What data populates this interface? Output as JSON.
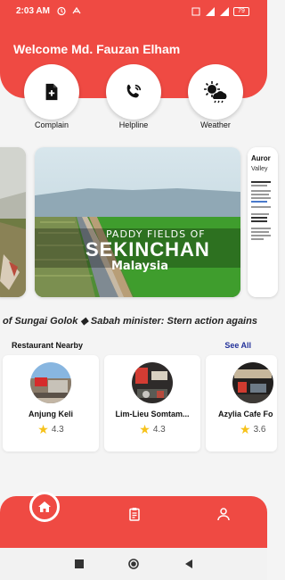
{
  "status": {
    "time": "2:03 AM",
    "battery": "79"
  },
  "header": {
    "welcome": "Welcome Md. Fauzan Elham"
  },
  "quick_actions": [
    {
      "label": "Complain",
      "icon": "add-file-icon"
    },
    {
      "label": "Helpline",
      "icon": "phone-icon"
    },
    {
      "label": "Weather",
      "icon": "weather-icon"
    }
  ],
  "banner": {
    "top_line": "PADDY FIELDS OF",
    "main_title": "SEKINCHAN",
    "country": "Malaysia",
    "side_card_title": "Auror",
    "side_card_sub": "Valley"
  },
  "news": {
    "ticker": "of Sungai Golok  ◆  Sabah minister: Stern action agains"
  },
  "restaurants": {
    "section_title": "Restaurant Nearby",
    "see_all": "See All",
    "items": [
      {
        "name": "Anjung Keli",
        "rating": "4.3"
      },
      {
        "name": "Lim-Lieu Somtam...",
        "rating": "4.3"
      },
      {
        "name": "Azylia Cafe Fo",
        "rating": "3.6"
      }
    ]
  },
  "bottom_nav": {
    "items": [
      "home-icon",
      "clipboard-icon",
      "profile-icon"
    ]
  },
  "colors": {
    "primary": "#ef4a43",
    "link": "#23329a",
    "star": "#f6c21a"
  }
}
